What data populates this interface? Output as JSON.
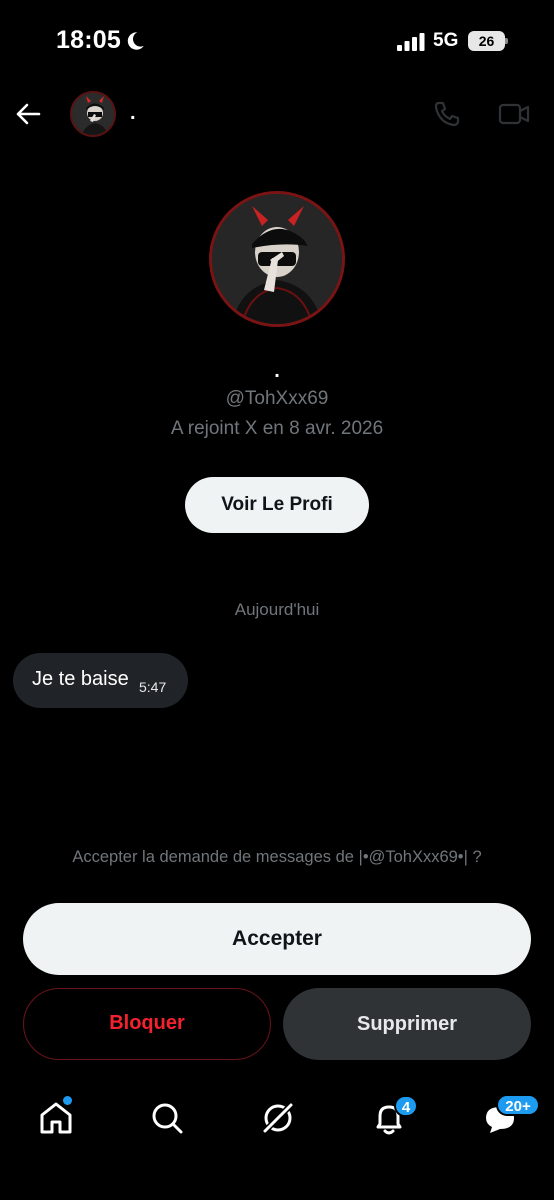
{
  "status_bar": {
    "time": "18:05",
    "network": "5G",
    "battery": "26",
    "icons": [
      "moon-icon",
      "signal-icon",
      "battery-icon"
    ]
  },
  "header": {
    "name": ".",
    "icons": [
      "back-arrow-icon",
      "phone-icon",
      "video-call-icon"
    ]
  },
  "profile": {
    "name": ".",
    "handle": "@TohXxx69",
    "joined": "A rejoint X en 8 avr. 2026",
    "view_profile_label": "Voir Le Profi"
  },
  "conversation": {
    "day_separator": "Aujourd'hui",
    "messages": [
      {
        "text": "Je te baise",
        "time": "5:47",
        "direction": "incoming"
      }
    ]
  },
  "request": {
    "prompt": "Accepter la demande de messages de |•@TohXxx69•| ?",
    "accept_label": "Accepter",
    "block_label": "Bloquer",
    "delete_label": "Supprimer"
  },
  "tabbar": {
    "tabs": [
      {
        "name": "home-icon",
        "indicator": "dot"
      },
      {
        "name": "search-icon"
      },
      {
        "name": "grok-icon"
      },
      {
        "name": "notifications-icon",
        "badge": "4"
      },
      {
        "name": "messages-icon",
        "badge": "20+"
      }
    ]
  },
  "colors": {
    "background": "#000000",
    "accent": "#1d9bf0",
    "danger": "#f4212e",
    "muted_text": "#71767b"
  }
}
